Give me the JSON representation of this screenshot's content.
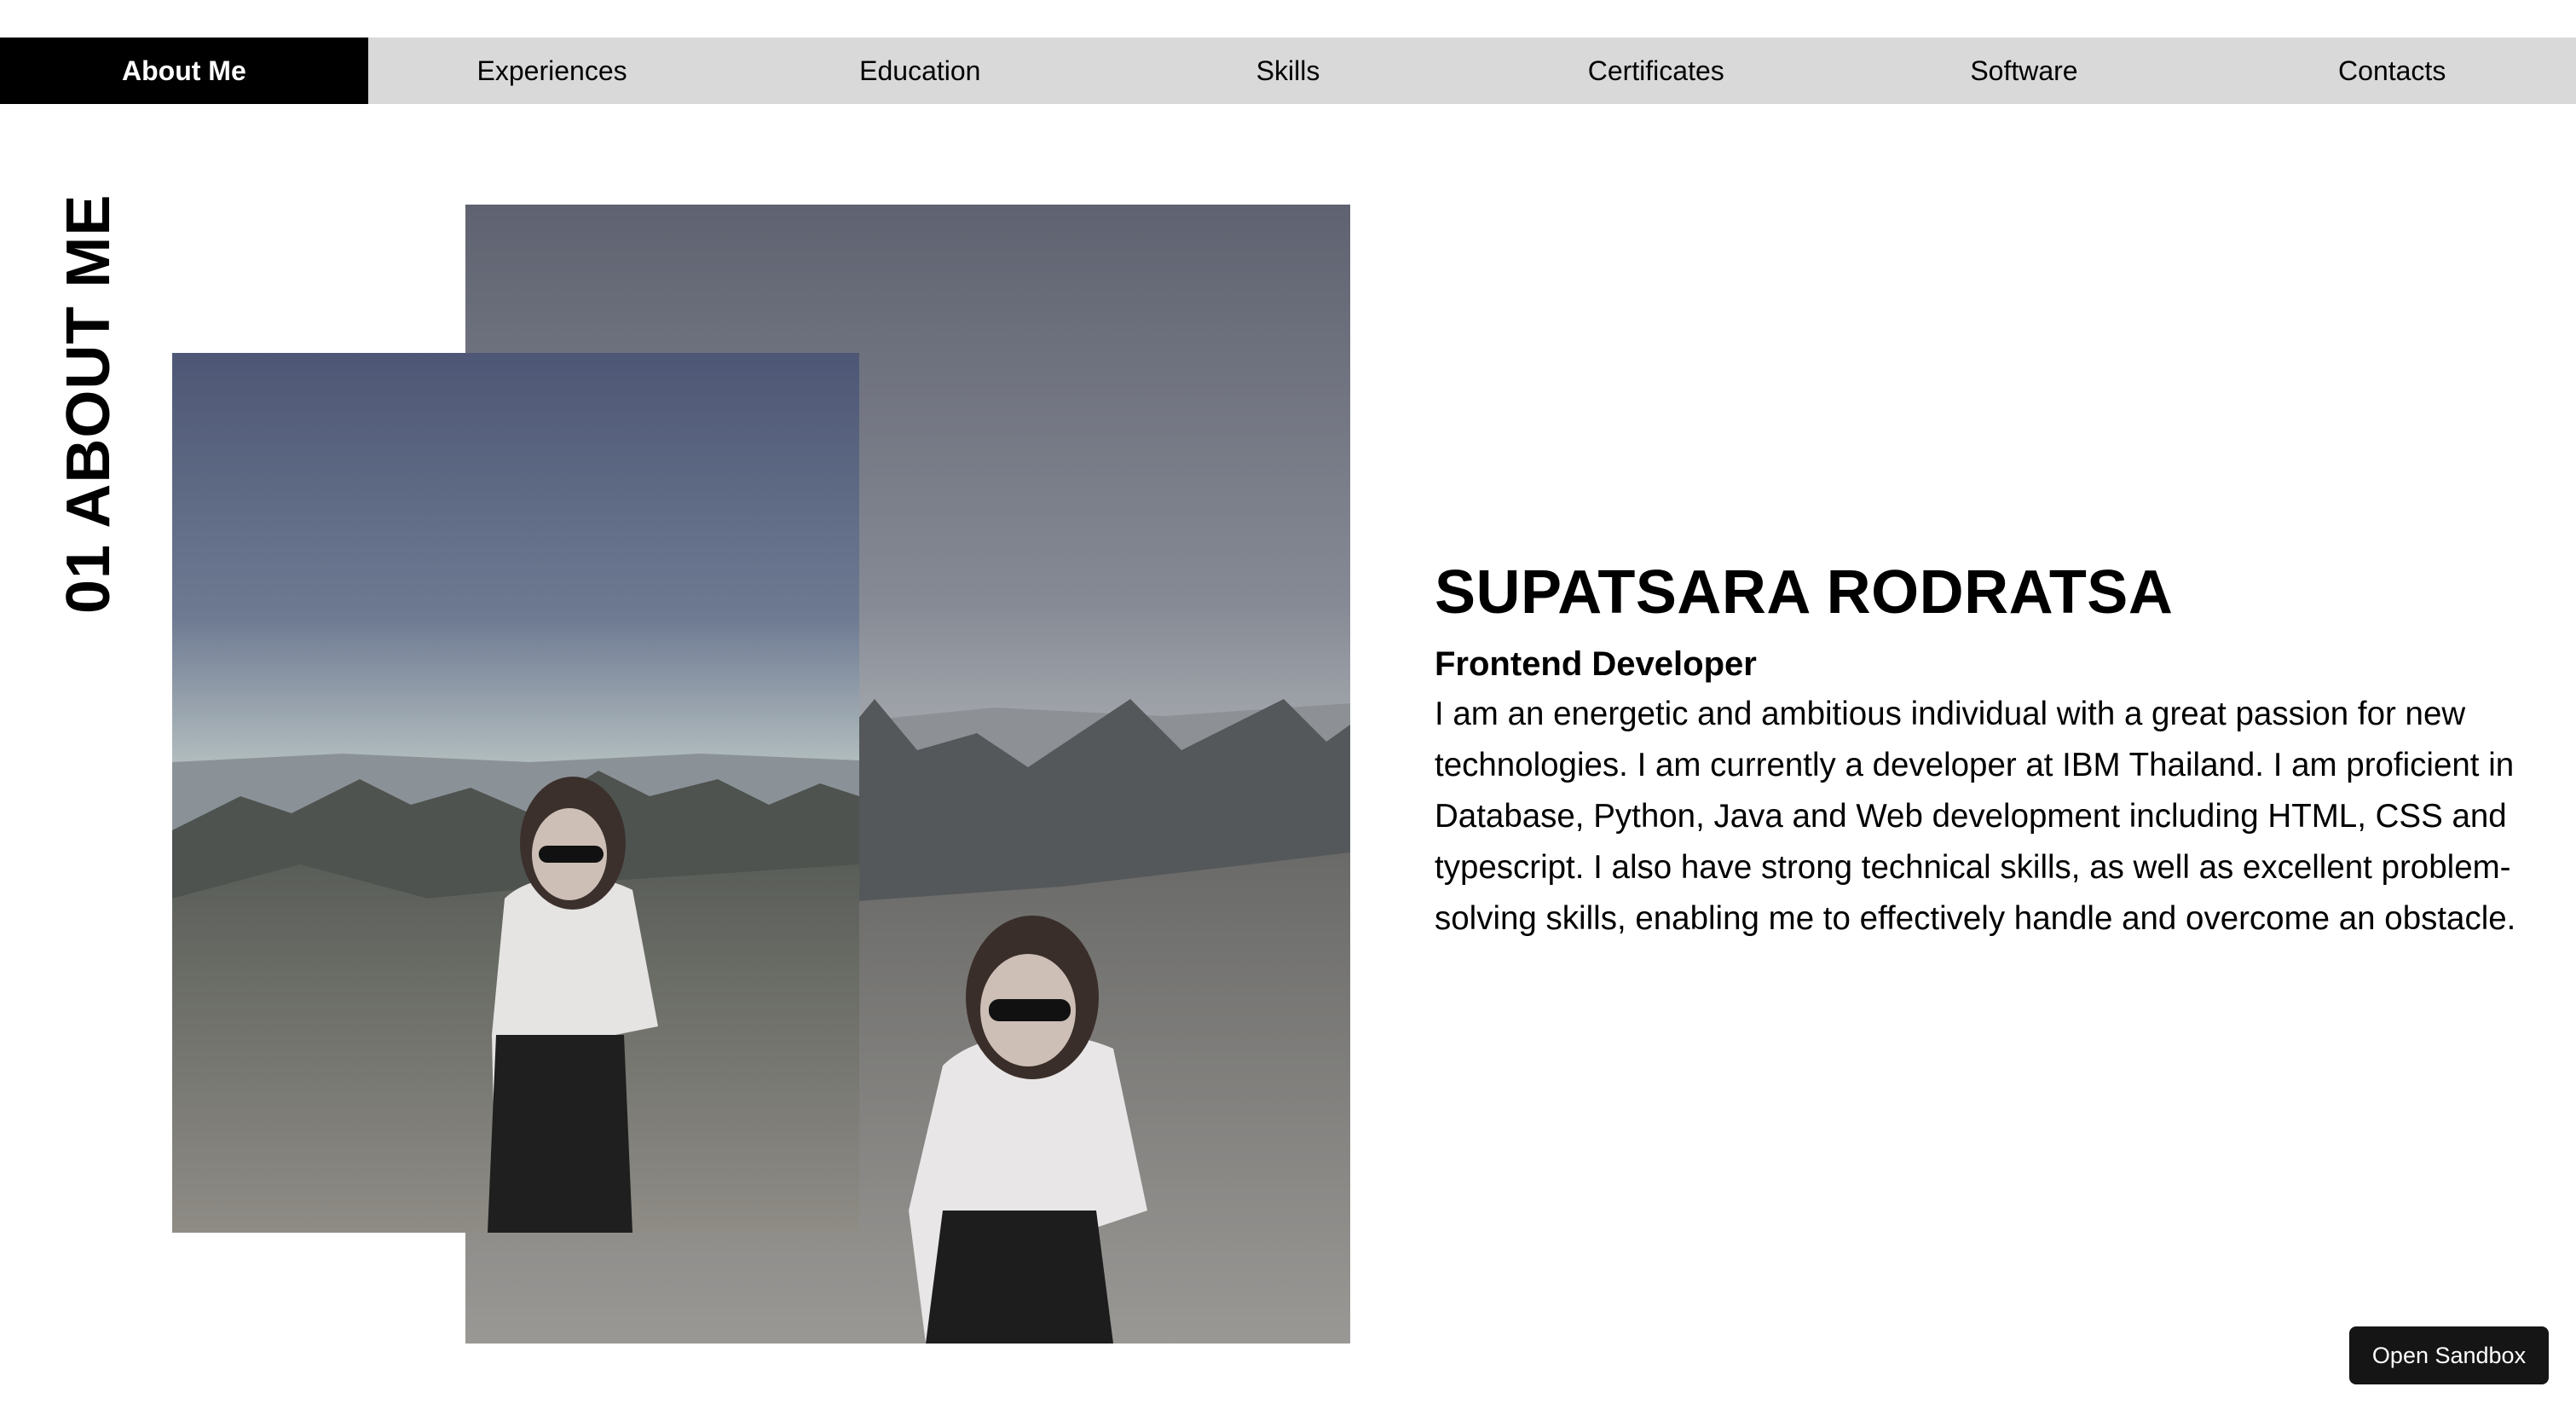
{
  "nav": {
    "items": [
      {
        "label": "About Me",
        "active": true
      },
      {
        "label": "Experiences",
        "active": false
      },
      {
        "label": "Education",
        "active": false
      },
      {
        "label": "Skills",
        "active": false
      },
      {
        "label": "Certificates",
        "active": false
      },
      {
        "label": "Software",
        "active": false
      },
      {
        "label": "Contacts",
        "active": false
      }
    ]
  },
  "section": {
    "title": "01 ABOUT ME"
  },
  "profile": {
    "name": "SUPATSARA RODRATSA",
    "role": "Frontend Developer",
    "bio": "I am an energetic and ambitious individual with a great passion for new technologies. I am currently a developer at IBM Thailand. I am proficient in Database, Python, Java and Web development including HTML, CSS and typescript. I also have strong technical skills, as well as excellent problem-solving skills, enabling me to effectively handle and overcome an obstacle."
  },
  "sandbox": {
    "label": "Open Sandbox"
  },
  "colors": {
    "nav_bg": "#d9d9d9",
    "nav_active_bg": "#000000",
    "nav_active_text": "#ffffff",
    "button_bg": "#151515"
  }
}
